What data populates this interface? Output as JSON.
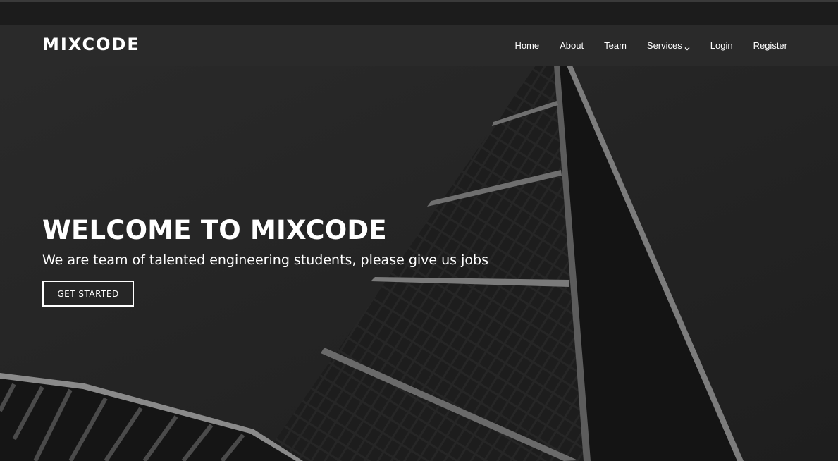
{
  "brand": {
    "logo_text": "MIXCODE"
  },
  "nav": {
    "items": [
      {
        "label": "Home"
      },
      {
        "label": "About"
      },
      {
        "label": "Team"
      },
      {
        "label": "Services",
        "has_dropdown": true
      },
      {
        "label": "Login"
      },
      {
        "label": "Register"
      }
    ]
  },
  "hero": {
    "title": "WELCOME TO MIXCODE",
    "subtitle": "We are team of talented engineering students, please give us jobs",
    "cta_label": "GET STARTED",
    "background": "grayscale photo of a glass skyscraper tip"
  },
  "colors": {
    "navbar": "#2a2a2a",
    "top_strip": "#1c1c1c",
    "text": "#ffffff"
  }
}
